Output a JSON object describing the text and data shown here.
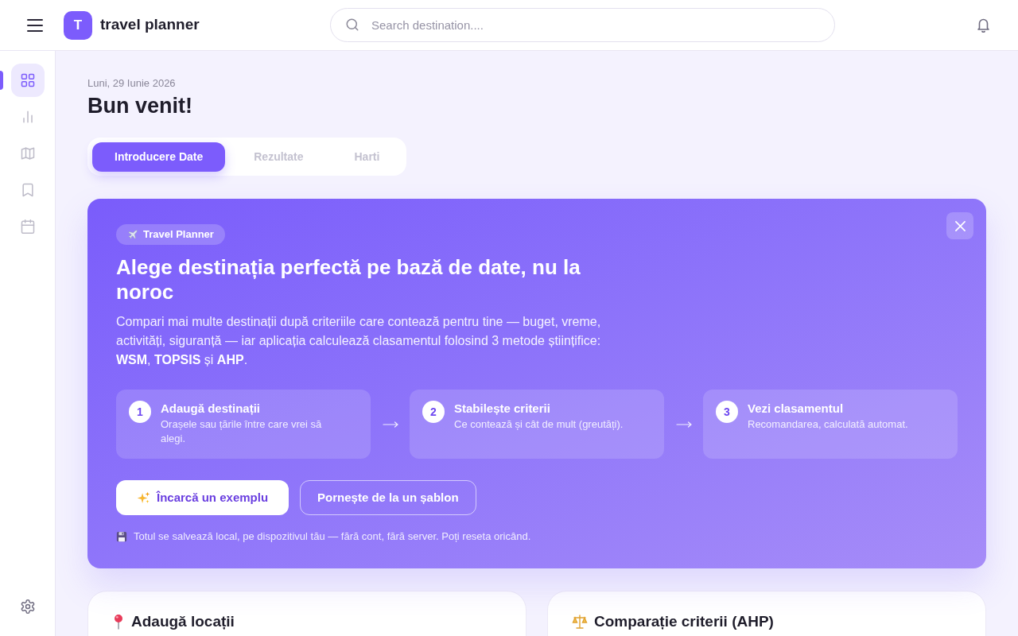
{
  "header": {
    "logo_letter": "T",
    "app_name": "travel planner",
    "search": {
      "placeholder": "Search destination...."
    }
  },
  "sidebar": {
    "items": [
      {
        "selected": true
      },
      {
        "selected": false
      },
      {
        "selected": false
      },
      {
        "selected": false
      },
      {
        "selected": false
      }
    ]
  },
  "page": {
    "date": "Luni, 29 Iunie 2026",
    "title": "Bun venit!"
  },
  "tabs": [
    {
      "label": "Introducere Date",
      "selected": true
    },
    {
      "label": "Rezultate",
      "selected": false
    },
    {
      "label": "Harti",
      "selected": false
    }
  ],
  "hero": {
    "badge": "Travel Planner",
    "title": "Alege destinația perfectă pe bază de date, nu la noroc",
    "description": "Compari mai multe destinații după criteriile care contează pentru tine — buget, vreme, activități, siguranță — iar aplicația calculează clasamentul folosind 3 metode științifice: **WSM**, **TOPSIS** și **AHP**.",
    "steps": [
      {
        "number": "1",
        "title": "Adaugă destinații",
        "text": "Orașele sau țările între care vrei să alegi."
      },
      {
        "number": "2",
        "title": "Stabilește criterii",
        "text": "Ce contează și cât de mult (greutăți)."
      },
      {
        "number": "3",
        "title": "Vezi clasamentul",
        "text": "Recomandarea, calculată automat."
      }
    ],
    "buttons": [
      {
        "label": "Încarcă un exemplu",
        "kind": "primary"
      },
      {
        "label": "Pornește de la un șablon",
        "kind": "outline"
      }
    ],
    "note": "Totul se salvează local, pe dispozitivul tău — fără cont, fără server. Poți reseta oricând."
  },
  "cards": [
    {
      "title": "Adaugă locații",
      "kind": "locations"
    },
    {
      "title": "Comparație criterii (AHP)",
      "kind": "criteria"
    }
  ]
}
